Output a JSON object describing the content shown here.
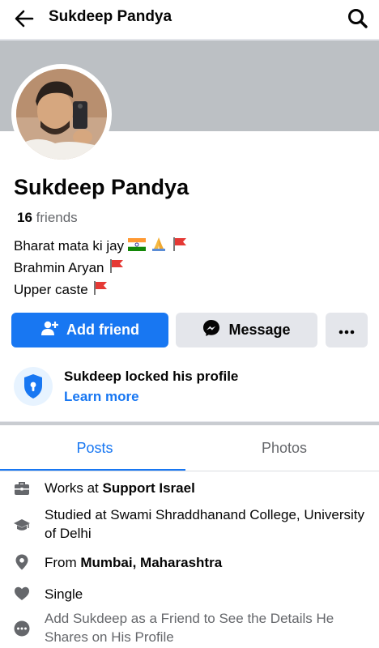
{
  "header": {
    "title": "Sukdeep Pandya"
  },
  "profile": {
    "name": "Sukdeep Pandya",
    "friends_count": "16",
    "friends_label": "friends",
    "bio": [
      "Bharat mata ki jay",
      "Brahmin Aryan",
      "Upper caste"
    ]
  },
  "actions": {
    "add_friend": "Add friend",
    "message": "Message",
    "more": "..."
  },
  "lock_notice": {
    "title": "Sukdeep locked his profile",
    "link": "Learn more"
  },
  "tabs": [
    {
      "label": "Posts",
      "active": true
    },
    {
      "label": "Photos",
      "active": false
    }
  ],
  "details": {
    "work_prefix": "Works at ",
    "work_place": "Support Israel",
    "study": "Studied at Swami Shraddhanand College, University of Delhi",
    "from_prefix": "From ",
    "from_place": "Mumbai, Maharashtra",
    "relationship": "Single",
    "more_info": "Add Sukdeep as a Friend to See the Details He Shares on His Profile"
  },
  "colors": {
    "accent": "#1877f2",
    "cover": "#bcc0c4",
    "button_gray": "#e4e6eb"
  },
  "icons": [
    "back-arrow-icon",
    "search-icon",
    "add-person-icon",
    "messenger-icon",
    "more-dots-icon",
    "shield-lock-icon",
    "briefcase-icon",
    "graduation-cap-icon",
    "location-pin-icon",
    "heart-icon",
    "more-circle-icon"
  ]
}
